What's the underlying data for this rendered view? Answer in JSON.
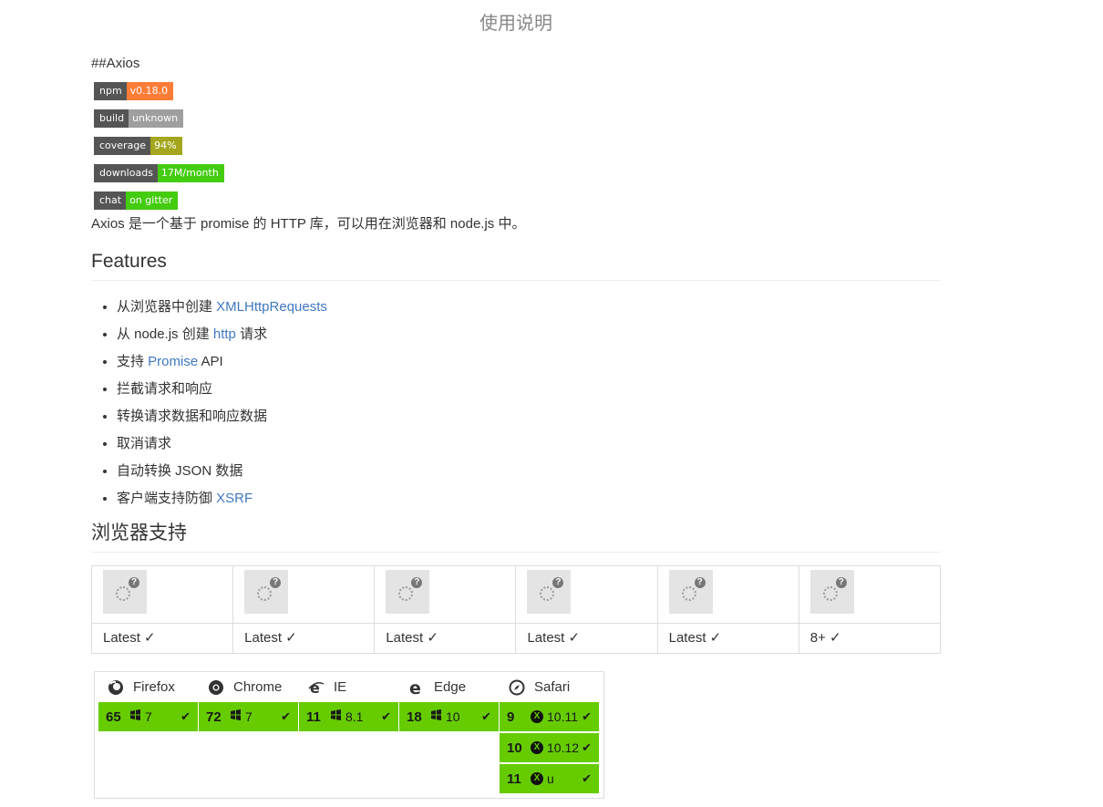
{
  "page_title": "使用说明",
  "raw_heading": "##Axios",
  "badges": [
    {
      "label": "npm",
      "value": "v0.18.0",
      "color": "#fe7d37"
    },
    {
      "label": "build",
      "value": "unknown",
      "color": "#9f9f9f"
    },
    {
      "label": "coverage",
      "value": "94%",
      "color": "#a4a61d"
    },
    {
      "label": "downloads",
      "value": "17M/month",
      "color": "#4c1"
    },
    {
      "label": "chat",
      "value": "on gitter",
      "color": "#4c1"
    }
  ],
  "intro": "Axios 是一个基于 promise 的 HTTP 库，可以用在浏览器和 node.js 中。",
  "features_heading": "Features",
  "features": [
    {
      "pre": "从浏览器中创建 ",
      "link": "XMLHttpRequests",
      "post": ""
    },
    {
      "pre": "从 node.js 创建 ",
      "link": "http",
      "post": " 请求"
    },
    {
      "pre": "支持 ",
      "link": "Promise",
      "post": " API"
    },
    {
      "pre": "拦截请求和响应",
      "link": "",
      "post": ""
    },
    {
      "pre": "转换请求数据和响应数据",
      "link": "",
      "post": ""
    },
    {
      "pre": "取消请求",
      "link": "",
      "post": ""
    },
    {
      "pre": "自动转换 JSON 数据",
      "link": "",
      "post": ""
    },
    {
      "pre": "客户端支持防御 ",
      "link": "XSRF",
      "post": ""
    }
  ],
  "browser_heading": "浏览器支持",
  "support_table": [
    "Latest ✓",
    "Latest ✓",
    "Latest ✓",
    "Latest ✓",
    "Latest ✓",
    "8+ ✓"
  ],
  "matrix": {
    "accent": "#66cc00",
    "browsers": [
      {
        "name": "Firefox",
        "icon": "firefox-icon",
        "rows": [
          {
            "v": "65",
            "os": "7"
          }
        ]
      },
      {
        "name": "Chrome",
        "icon": "chrome-icon",
        "rows": [
          {
            "v": "72",
            "os": "7"
          }
        ]
      },
      {
        "name": "IE",
        "icon": "ie-icon",
        "rows": [
          {
            "v": "11",
            "os": "8.1"
          }
        ]
      },
      {
        "name": "Edge",
        "icon": "edge-icon",
        "rows": [
          {
            "v": "18",
            "os": "10"
          }
        ]
      },
      {
        "name": "Safari",
        "icon": "safari-icon",
        "rows": [
          {
            "v": "9",
            "os": "10.11"
          },
          {
            "v": "10",
            "os": "10.12"
          },
          {
            "v": "11",
            "os": "u"
          }
        ]
      }
    ]
  }
}
